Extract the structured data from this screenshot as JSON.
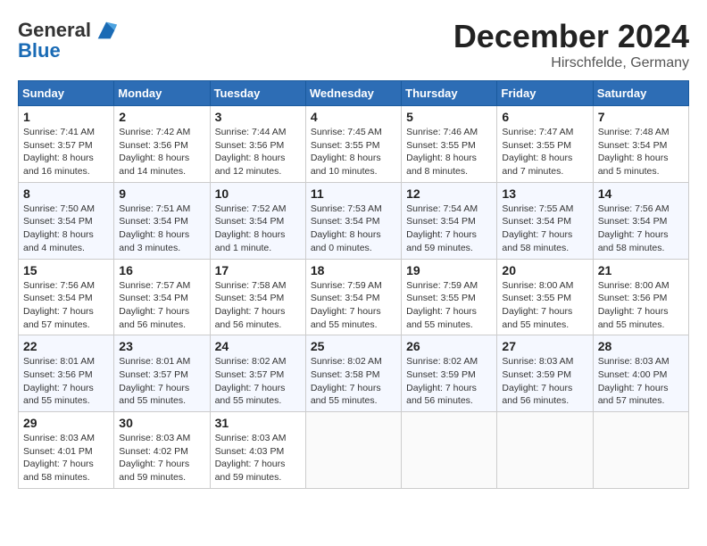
{
  "header": {
    "logo_line1": "General",
    "logo_line2": "Blue",
    "month": "December 2024",
    "location": "Hirschfelde, Germany"
  },
  "days_of_week": [
    "Sunday",
    "Monday",
    "Tuesday",
    "Wednesday",
    "Thursday",
    "Friday",
    "Saturday"
  ],
  "weeks": [
    [
      {
        "day": 1,
        "sunrise": "7:41 AM",
        "sunset": "3:57 PM",
        "daylight": "8 hours and 16 minutes."
      },
      {
        "day": 2,
        "sunrise": "7:42 AM",
        "sunset": "3:56 PM",
        "daylight": "8 hours and 14 minutes."
      },
      {
        "day": 3,
        "sunrise": "7:44 AM",
        "sunset": "3:56 PM",
        "daylight": "8 hours and 12 minutes."
      },
      {
        "day": 4,
        "sunrise": "7:45 AM",
        "sunset": "3:55 PM",
        "daylight": "8 hours and 10 minutes."
      },
      {
        "day": 5,
        "sunrise": "7:46 AM",
        "sunset": "3:55 PM",
        "daylight": "8 hours and 8 minutes."
      },
      {
        "day": 6,
        "sunrise": "7:47 AM",
        "sunset": "3:55 PM",
        "daylight": "8 hours and 7 minutes."
      },
      {
        "day": 7,
        "sunrise": "7:48 AM",
        "sunset": "3:54 PM",
        "daylight": "8 hours and 5 minutes."
      }
    ],
    [
      {
        "day": 8,
        "sunrise": "7:50 AM",
        "sunset": "3:54 PM",
        "daylight": "8 hours and 4 minutes."
      },
      {
        "day": 9,
        "sunrise": "7:51 AM",
        "sunset": "3:54 PM",
        "daylight": "8 hours and 3 minutes."
      },
      {
        "day": 10,
        "sunrise": "7:52 AM",
        "sunset": "3:54 PM",
        "daylight": "8 hours and 1 minute."
      },
      {
        "day": 11,
        "sunrise": "7:53 AM",
        "sunset": "3:54 PM",
        "daylight": "8 hours and 0 minutes."
      },
      {
        "day": 12,
        "sunrise": "7:54 AM",
        "sunset": "3:54 PM",
        "daylight": "7 hours and 59 minutes."
      },
      {
        "day": 13,
        "sunrise": "7:55 AM",
        "sunset": "3:54 PM",
        "daylight": "7 hours and 58 minutes."
      },
      {
        "day": 14,
        "sunrise": "7:56 AM",
        "sunset": "3:54 PM",
        "daylight": "7 hours and 58 minutes."
      }
    ],
    [
      {
        "day": 15,
        "sunrise": "7:56 AM",
        "sunset": "3:54 PM",
        "daylight": "7 hours and 57 minutes."
      },
      {
        "day": 16,
        "sunrise": "7:57 AM",
        "sunset": "3:54 PM",
        "daylight": "7 hours and 56 minutes."
      },
      {
        "day": 17,
        "sunrise": "7:58 AM",
        "sunset": "3:54 PM",
        "daylight": "7 hours and 56 minutes."
      },
      {
        "day": 18,
        "sunrise": "7:59 AM",
        "sunset": "3:54 PM",
        "daylight": "7 hours and 55 minutes."
      },
      {
        "day": 19,
        "sunrise": "7:59 AM",
        "sunset": "3:55 PM",
        "daylight": "7 hours and 55 minutes."
      },
      {
        "day": 20,
        "sunrise": "8:00 AM",
        "sunset": "3:55 PM",
        "daylight": "7 hours and 55 minutes."
      },
      {
        "day": 21,
        "sunrise": "8:00 AM",
        "sunset": "3:56 PM",
        "daylight": "7 hours and 55 minutes."
      }
    ],
    [
      {
        "day": 22,
        "sunrise": "8:01 AM",
        "sunset": "3:56 PM",
        "daylight": "7 hours and 55 minutes."
      },
      {
        "day": 23,
        "sunrise": "8:01 AM",
        "sunset": "3:57 PM",
        "daylight": "7 hours and 55 minutes."
      },
      {
        "day": 24,
        "sunrise": "8:02 AM",
        "sunset": "3:57 PM",
        "daylight": "7 hours and 55 minutes."
      },
      {
        "day": 25,
        "sunrise": "8:02 AM",
        "sunset": "3:58 PM",
        "daylight": "7 hours and 55 minutes."
      },
      {
        "day": 26,
        "sunrise": "8:02 AM",
        "sunset": "3:59 PM",
        "daylight": "7 hours and 56 minutes."
      },
      {
        "day": 27,
        "sunrise": "8:03 AM",
        "sunset": "3:59 PM",
        "daylight": "7 hours and 56 minutes."
      },
      {
        "day": 28,
        "sunrise": "8:03 AM",
        "sunset": "4:00 PM",
        "daylight": "7 hours and 57 minutes."
      }
    ],
    [
      {
        "day": 29,
        "sunrise": "8:03 AM",
        "sunset": "4:01 PM",
        "daylight": "7 hours and 58 minutes."
      },
      {
        "day": 30,
        "sunrise": "8:03 AM",
        "sunset": "4:02 PM",
        "daylight": "7 hours and 59 minutes."
      },
      {
        "day": 31,
        "sunrise": "8:03 AM",
        "sunset": "4:03 PM",
        "daylight": "7 hours and 59 minutes."
      },
      null,
      null,
      null,
      null
    ]
  ]
}
